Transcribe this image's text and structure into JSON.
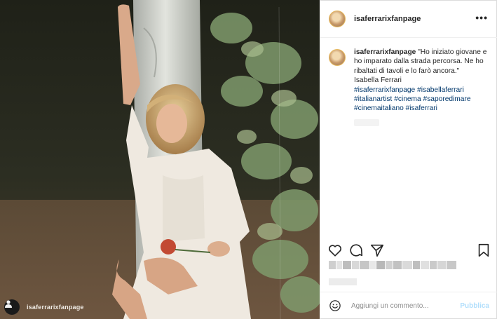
{
  "post": {
    "username": "isaferrarixfanpage",
    "more_label": "•••"
  },
  "caption": {
    "username": "isaferrarixfanpage",
    "quote": "\"Ho iniziato giovane e ho imparato dalla strada percorsa. Ne ho ribaltati di tavoli e lo farò ancora.\"",
    "author": "Isabella Ferrari",
    "hashtags": [
      "#isaferrarixfanpage",
      "#isabellaferrari",
      "#italianartist",
      "#cinema",
      "#saporedimare",
      "#cinemaitaliano",
      "#isaferrari"
    ]
  },
  "photo": {
    "watermark": "isaferrarixfanpage"
  },
  "actions": {
    "icons": [
      "heart-icon",
      "comment-icon",
      "share-icon",
      "bookmark-icon"
    ]
  },
  "comment_bar": {
    "placeholder": "Aggiungi un commento...",
    "publish_label": "Pubblica"
  },
  "colors": {
    "hashtag": "#00376b",
    "publish_disabled": "#b2dffc",
    "muted": "#8e8e8e",
    "border": "#efefef"
  }
}
